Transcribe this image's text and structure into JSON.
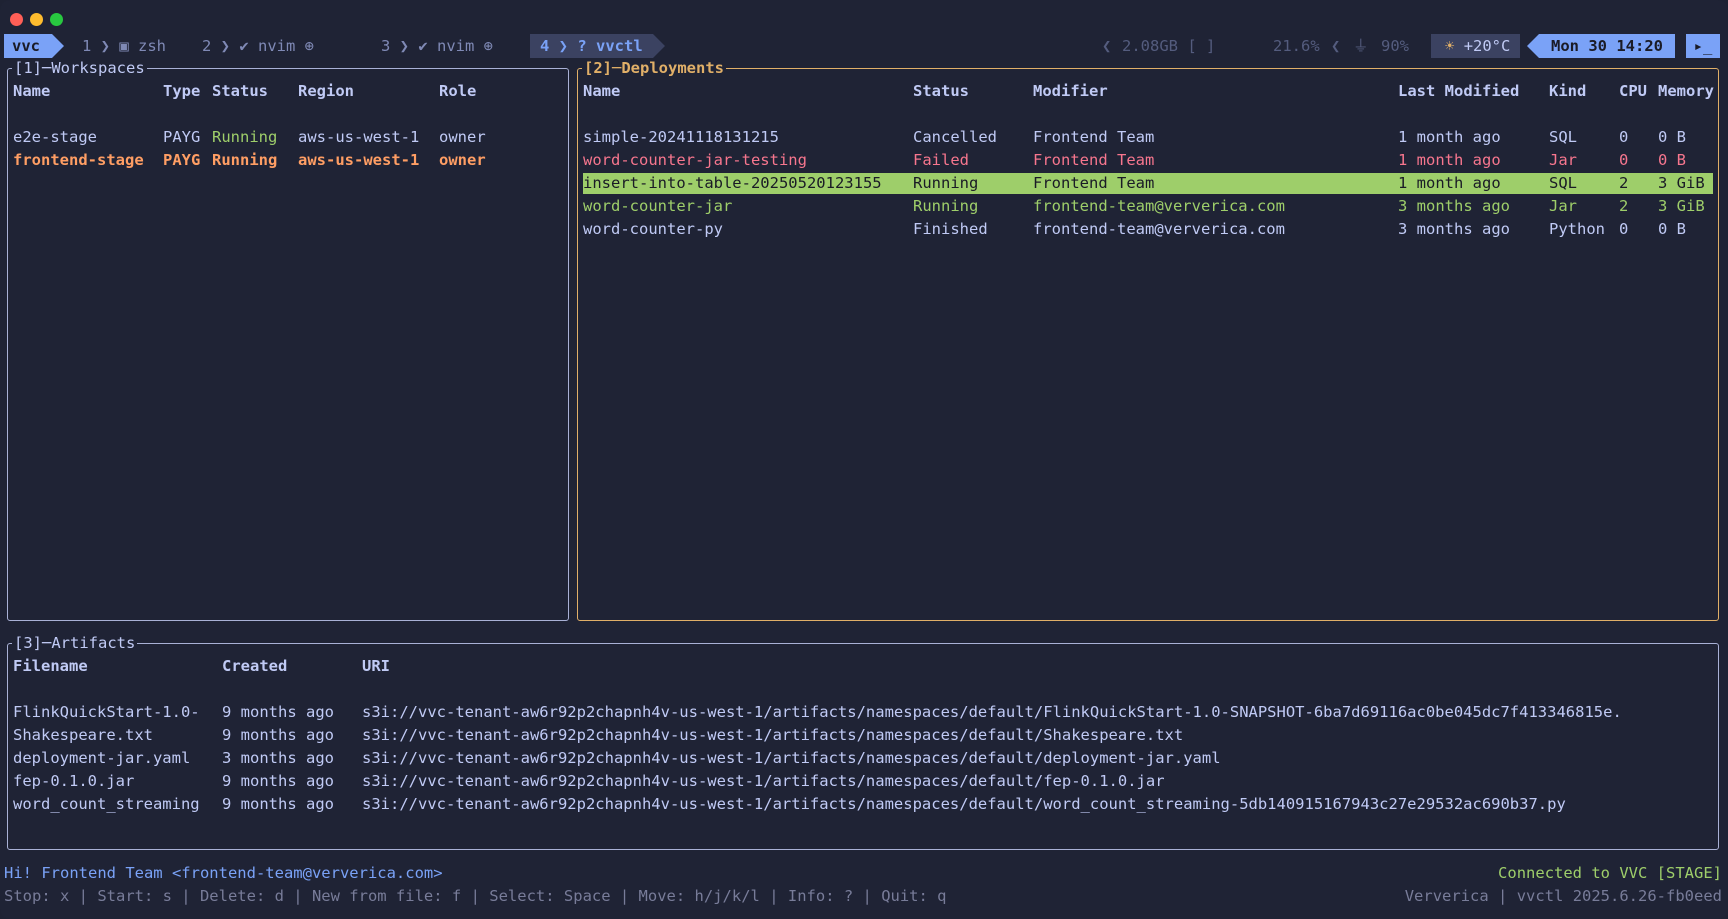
{
  "tmux": {
    "session": "vvc",
    "windows": [
      {
        "num": "1",
        "icon": "terminal-icon",
        "name": "zsh"
      },
      {
        "num": "2",
        "icon": "vim-icon",
        "name": "nvim"
      },
      {
        "num": "3",
        "icon": "vim-icon",
        "name": "nvim"
      },
      {
        "num": "4",
        "icon": "help-icon",
        "name": "vvctl"
      }
    ],
    "win1": "1 ❯ ▣ zsh",
    "win2": "2 ❯ ✔ nvim ⊕",
    "win3": "3 ❯ ✔ nvim ⊕",
    "win4": "4 ❯ ? vvctl",
    "memory": "2.08GB [     ]",
    "cpu": "21.6%",
    "battery": "90%",
    "temperature": "+20°C",
    "clock": "Mon 30 14:20"
  },
  "workspaces": {
    "title": "[1]─Workspaces",
    "headers": {
      "name": "Name",
      "type": "Type",
      "status": "Status",
      "region": "Region",
      "role": "Role"
    },
    "rows": [
      {
        "name": "e2e-stage",
        "type": "PAYG",
        "status": "Running",
        "region": "aws-us-west-1",
        "role": "owner"
      },
      {
        "name": "frontend-stage",
        "type": "PAYG",
        "status": "Running",
        "region": "aws-us-west-1",
        "role": "owner"
      }
    ]
  },
  "deployments": {
    "title": "[2]─Deployments",
    "headers": {
      "name": "Name",
      "status": "Status",
      "modifier": "Modifier",
      "last_modified": "Last Modified",
      "kind": "Kind",
      "cpu": "CPU",
      "memory": "Memory"
    },
    "rows": [
      {
        "name": "simple-20241118131215",
        "status": "Cancelled",
        "modifier": "Frontend Team",
        "last_modified": "1 month ago",
        "kind": "SQL",
        "cpu": "0",
        "memory": "0 B"
      },
      {
        "name": "word-counter-jar-testing",
        "status": "Failed",
        "modifier": "Frontend Team",
        "last_modified": "1 month ago",
        "kind": "Jar",
        "cpu": "0",
        "memory": "0 B"
      },
      {
        "name": "insert-into-table-20250520123155",
        "status": "Running",
        "modifier": "Frontend Team",
        "last_modified": "1 month ago",
        "kind": "SQL",
        "cpu": "2",
        "memory": "3 GiB"
      },
      {
        "name": "word-counter-jar",
        "status": "Running",
        "modifier": "frontend-team@ververica.com",
        "last_modified": "3 months ago",
        "kind": "Jar",
        "cpu": "2",
        "memory": "3 GiB"
      },
      {
        "name": "word-counter-py",
        "status": "Finished",
        "modifier": "frontend-team@ververica.com",
        "last_modified": "3 months ago",
        "kind": "Python",
        "cpu": "0",
        "memory": "0 B"
      }
    ]
  },
  "artifacts": {
    "title": "[3]─Artifacts",
    "headers": {
      "filename": "Filename",
      "created": "Created",
      "uri": "URI"
    },
    "rows": [
      {
        "filename": "FlinkQuickStart-1.0-",
        "created": "9 months ago",
        "uri": "s3i://vvc-tenant-aw6r92p2chapnh4v-us-west-1/artifacts/namespaces/default/FlinkQuickStart-1.0-SNAPSHOT-6ba7d69116ac0be045dc7f413346815e."
      },
      {
        "filename": "Shakespeare.txt",
        "created": "9 months ago",
        "uri": "s3i://vvc-tenant-aw6r92p2chapnh4v-us-west-1/artifacts/namespaces/default/Shakespeare.txt"
      },
      {
        "filename": "deployment-jar.yaml",
        "created": "3 months ago",
        "uri": "s3i://vvc-tenant-aw6r92p2chapnh4v-us-west-1/artifacts/namespaces/default/deployment-jar.yaml"
      },
      {
        "filename": "fep-0.1.0.jar",
        "created": "9 months ago",
        "uri": "s3i://vvc-tenant-aw6r92p2chapnh4v-us-west-1/artifacts/namespaces/default/fep-0.1.0.jar"
      },
      {
        "filename": "word_count_streaming",
        "created": "9 months ago",
        "uri": "s3i://vvc-tenant-aw6r92p2chapnh4v-us-west-1/artifacts/namespaces/default/word_count_streaming-5db140915167943c27e29532ac690b37.py"
      }
    ]
  },
  "footer": {
    "greeting": "Hi! Frontend Team <frontend-team@ververica.com>",
    "connection": "Connected to VVC [STAGE]",
    "keybindings": "Stop: x | Start: s | Delete: d | New from file: f | Select: Space | Move: h/j/k/l | Info: ? | Quit: q",
    "version": "Ververica | vvctl 2025.6.26-fb0eed"
  },
  "colors": {
    "background": "#1f2335",
    "accent_blue": "#7aa2f7",
    "running_green": "#9ece6a",
    "failed_red": "#f7768e",
    "active_border": "#e0af68",
    "selected_workspace": "#ff9e64"
  }
}
